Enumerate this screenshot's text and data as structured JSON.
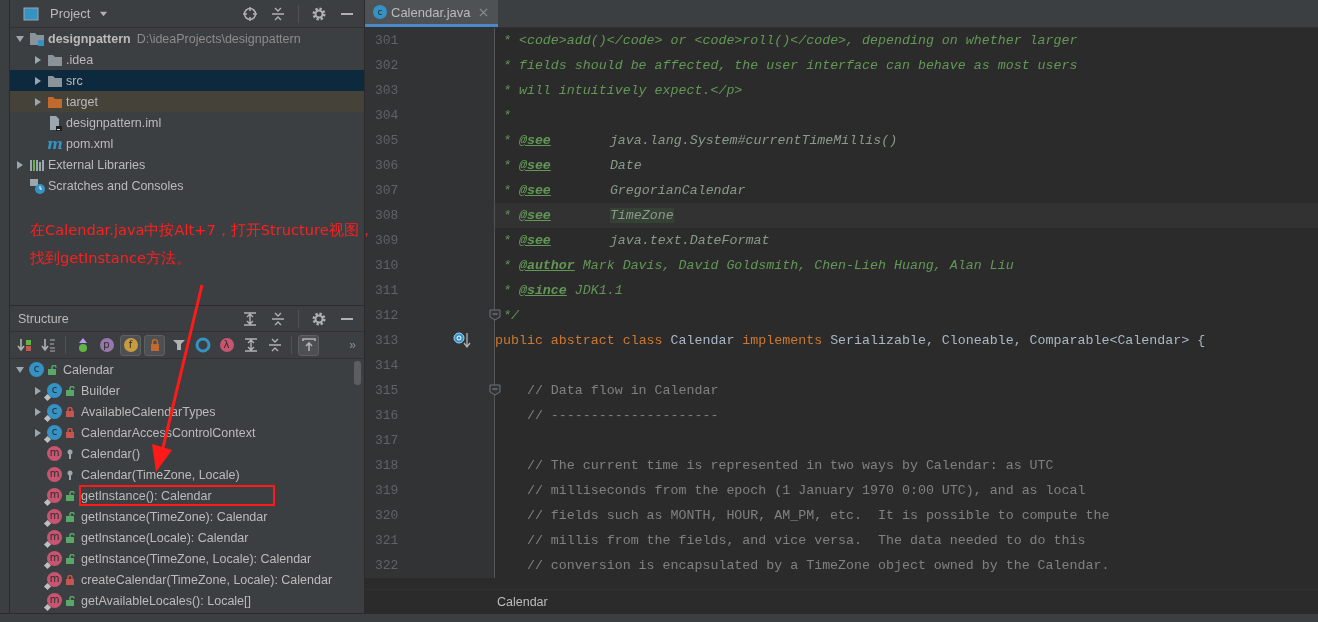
{
  "project_panel": {
    "title": "Project",
    "tree": [
      {
        "name": "designpattern",
        "path": "D:\\ideaProjects\\designpattern",
        "kind": "module",
        "expanded": true,
        "selected": false,
        "children": [
          {
            "name": ".idea",
            "kind": "folder",
            "expanded": false,
            "selected": false
          },
          {
            "name": "src",
            "kind": "folder",
            "expanded": false,
            "selected": true
          },
          {
            "name": "target",
            "kind": "excluded-folder",
            "expanded": false,
            "selected": false
          },
          {
            "name": "designpattern.iml",
            "kind": "file",
            "selected": false
          },
          {
            "name": "pom.xml",
            "kind": "maven",
            "glyph": "m",
            "selected": false
          }
        ]
      },
      {
        "name": "External Libraries",
        "kind": "libraries",
        "expanded": false,
        "selected": false
      },
      {
        "name": "Scratches and Consoles",
        "kind": "scratches",
        "selected": false
      }
    ]
  },
  "annotation": {
    "lines": [
      "在Calendar.java中按Alt+7，打开Structure视图，",
      "找到getInstance方法。"
    ]
  },
  "structure_panel": {
    "title": "Structure",
    "toolbar": [
      {
        "kind": "sort-visibility",
        "on": false
      },
      {
        "kind": "sort-alpha",
        "on": false
      },
      {
        "kind": "inherited",
        "on": false
      },
      {
        "kind": "properties",
        "glyph": "p",
        "on": false
      },
      {
        "kind": "fields",
        "glyph": "f",
        "on": true
      },
      {
        "kind": "non-public",
        "on": true
      },
      {
        "kind": "filter",
        "on": false
      },
      {
        "kind": "anonymous",
        "on": false
      },
      {
        "kind": "lambdas",
        "glyph": "λ",
        "on": false
      },
      {
        "kind": "expand-all",
        "on": false
      },
      {
        "kind": "collapse-all",
        "on": false
      },
      {
        "kind": "autoscroll",
        "on": true
      }
    ],
    "more": "»",
    "tree": [
      {
        "name": "Calendar",
        "kind": "class",
        "glyph": "c",
        "private": false,
        "package_private": false,
        "static": false,
        "boxed": false,
        "expanded": true,
        "children": [
          {
            "name": "Builder",
            "kind": "class",
            "glyph": "c",
            "private": false,
            "package_private": false,
            "static": true,
            "boxed": false,
            "expanded": false
          },
          {
            "name": "AvailableCalendarTypes",
            "kind": "class",
            "glyph": "c",
            "private": true,
            "package_private": false,
            "static": true,
            "boxed": false,
            "expanded": false
          },
          {
            "name": "CalendarAccessControlContext",
            "kind": "class",
            "glyph": "c",
            "private": true,
            "package_private": false,
            "static": true,
            "boxed": false,
            "expanded": false
          },
          {
            "name": "Calendar()",
            "kind": "method",
            "glyph": "m",
            "private": false,
            "package_private": true,
            "static": false,
            "boxed": false
          },
          {
            "name": "Calendar(TimeZone, Locale)",
            "kind": "method",
            "glyph": "m",
            "private": false,
            "package_private": true,
            "static": false,
            "boxed": false
          },
          {
            "name": "getInstance(): Calendar",
            "kind": "method",
            "glyph": "m",
            "private": false,
            "package_private": false,
            "static": true,
            "boxed": true
          },
          {
            "name": "getInstance(TimeZone): Calendar",
            "kind": "method",
            "glyph": "m",
            "private": false,
            "package_private": false,
            "static": true,
            "boxed": false
          },
          {
            "name": "getInstance(Locale): Calendar",
            "kind": "method",
            "glyph": "m",
            "private": false,
            "package_private": false,
            "static": true,
            "boxed": false
          },
          {
            "name": "getInstance(TimeZone, Locale): Calendar",
            "kind": "method",
            "glyph": "m",
            "private": false,
            "package_private": false,
            "static": true,
            "boxed": false
          },
          {
            "name": "createCalendar(TimeZone, Locale): Calendar",
            "kind": "method",
            "glyph": "m",
            "private": true,
            "package_private": false,
            "static": true,
            "boxed": false
          },
          {
            "name": "getAvailableLocales(): Locale[]",
            "kind": "method",
            "glyph": "m",
            "private": false,
            "package_private": false,
            "static": true,
            "boxed": false
          }
        ]
      }
    ]
  },
  "editor": {
    "tabs": [
      {
        "label": "Calendar.java",
        "glyph": "c",
        "selected": true
      }
    ],
    "lines": [
      {
        "number": "301",
        "kind": "doc",
        "segments": [
          {
            "kind": "doc",
            "text": "* <code>add()</code> or <code>roll()</code>, depending on whether larger"
          }
        ]
      },
      {
        "number": "302",
        "kind": "doc",
        "segments": [
          {
            "kind": "doc",
            "text": "* fields should be affected, the user interface can behave as most users"
          }
        ]
      },
      {
        "number": "303",
        "kind": "doc",
        "segments": [
          {
            "kind": "doc",
            "text": "* will intuitively expect.</p>"
          }
        ]
      },
      {
        "number": "304",
        "kind": "doc",
        "segments": [
          {
            "kind": "doc",
            "text": "*"
          }
        ]
      },
      {
        "number": "305",
        "kind": "doc",
        "segments": [
          {
            "kind": "doc",
            "text": "*"
          },
          {
            "kind": "tag",
            "text": "@see"
          },
          {
            "kind": "ref",
            "text": "java.lang.System#currentTimeMillis()"
          }
        ]
      },
      {
        "number": "306",
        "kind": "doc",
        "segments": [
          {
            "kind": "doc",
            "text": "*"
          },
          {
            "kind": "tag",
            "text": "@see"
          },
          {
            "kind": "ref",
            "text": "Date"
          }
        ]
      },
      {
        "number": "307",
        "kind": "doc",
        "segments": [
          {
            "kind": "doc",
            "text": "*"
          },
          {
            "kind": "tag",
            "text": "@see"
          },
          {
            "kind": "ref",
            "text": "GregorianCalendar"
          }
        ]
      },
      {
        "number": "308",
        "kind": "doc",
        "current": true,
        "segments": [
          {
            "kind": "doc",
            "text": "*"
          },
          {
            "kind": "tag",
            "text": "@see"
          },
          {
            "kind": "ref",
            "text": "TimeZone",
            "highlighted": true
          }
        ]
      },
      {
        "number": "309",
        "kind": "doc",
        "segments": [
          {
            "kind": "doc",
            "text": "*"
          },
          {
            "kind": "tag",
            "text": "@see"
          },
          {
            "kind": "ref",
            "text": "java.text.DateFormat"
          }
        ]
      },
      {
        "number": "310",
        "kind": "doc",
        "segments": [
          {
            "kind": "doc",
            "text": "*"
          },
          {
            "kind": "tag",
            "text": "@author"
          },
          {
            "kind": "doc",
            "text": "Mark Davis, David Goldsmith, Chen-Lieh Huang, Alan Liu"
          }
        ]
      },
      {
        "number": "311",
        "kind": "doc",
        "segments": [
          {
            "kind": "doc",
            "text": "*"
          },
          {
            "kind": "tag",
            "text": "@since"
          },
          {
            "kind": "doc",
            "text": "JDK1.1"
          }
        ]
      },
      {
        "number": "312",
        "kind": "doc",
        "fold": true,
        "segments": [
          {
            "kind": "doc",
            "text": "*/"
          }
        ]
      },
      {
        "number": "313",
        "kind": "code",
        "overrides": true,
        "segments": [
          {
            "kind": "keyword",
            "text": "public"
          },
          {
            "kind": "keyword",
            "text": "abstract"
          },
          {
            "kind": "keyword",
            "text": "class"
          },
          {
            "kind": "plain",
            "text": "Calendar"
          },
          {
            "kind": "keyword",
            "text": "implements"
          },
          {
            "kind": "plain",
            "text": "Serializable, Cloneable, Comparable<Calendar> {"
          }
        ]
      },
      {
        "number": "314",
        "kind": "blank"
      },
      {
        "number": "315",
        "kind": "comment",
        "fold": true,
        "segments": [
          {
            "kind": "comment",
            "text": "// Data flow in Calendar"
          }
        ]
      },
      {
        "number": "316",
        "kind": "comment",
        "segments": [
          {
            "kind": "comment",
            "text": "// ---------------------"
          }
        ]
      },
      {
        "number": "317",
        "kind": "blank"
      },
      {
        "number": "318",
        "kind": "comment",
        "segments": [
          {
            "kind": "comment",
            "text": "// The current time is represented in two ways by Calendar: as UTC"
          }
        ]
      },
      {
        "number": "319",
        "kind": "comment",
        "segments": [
          {
            "kind": "comment",
            "text": "// milliseconds from the epoch (1 January 1970 0:00 UTC), and as local"
          }
        ]
      },
      {
        "number": "320",
        "kind": "comment",
        "segments": [
          {
            "kind": "comment",
            "text": "// fields such as MONTH, HOUR, AM_PM, etc.  It is possible to compute the"
          }
        ]
      },
      {
        "number": "321",
        "kind": "comment",
        "segments": [
          {
            "kind": "comment",
            "text": "// millis from the fields, and vice versa.  The data needed to do this"
          }
        ]
      },
      {
        "number": "322",
        "kind": "comment",
        "segments": [
          {
            "kind": "comment",
            "text": "// conversion is encapsulated by a TimeZone object owned by the Calendar."
          }
        ]
      }
    ],
    "breadcrumb": "Calendar"
  }
}
